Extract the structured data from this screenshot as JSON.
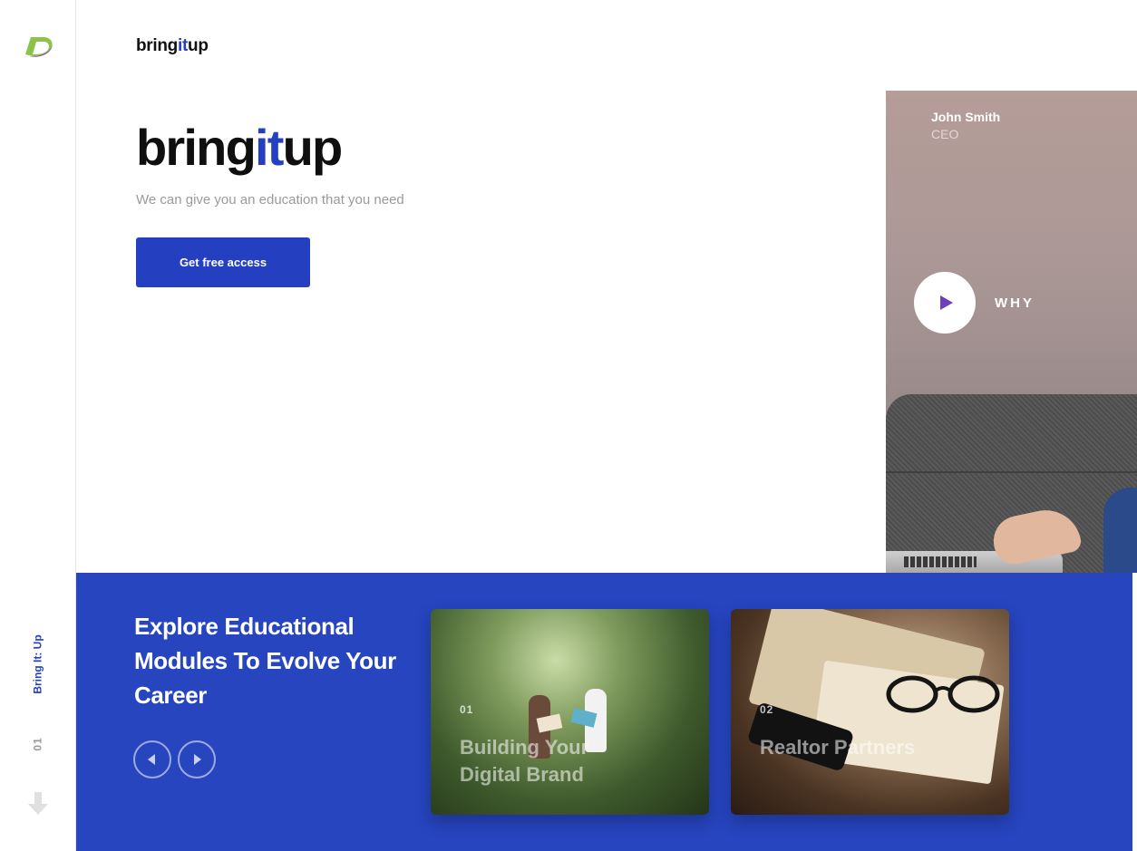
{
  "sidebar": {
    "vertical_label": "Bring It: Up",
    "slide_number": "01",
    "logo_icon": "brand-logo-icon",
    "arrow_icon": "arrow-down-icon"
  },
  "header": {
    "logo_prefix": "bring",
    "logo_it": "it",
    "logo_suffix": "up"
  },
  "hero": {
    "title_prefix": "bring",
    "title_it": "it",
    "title_suffix": "up",
    "subtitle": "We can give you an education that you need",
    "cta_label": "Get free access"
  },
  "video": {
    "person_name": "John Smith",
    "person_role": "CEO",
    "why_label": "WHY",
    "play_icon": "play-icon"
  },
  "modules": {
    "title": "Explore Educational Modules To Evolve Your Career",
    "prev_icon": "chevron-left-icon",
    "next_icon": "chevron-right-icon",
    "cards": [
      {
        "number": "01",
        "title": "Building Your Digital Brand"
      },
      {
        "number": "02",
        "title": "Realtor Partners"
      }
    ]
  },
  "colors": {
    "brand_blue": "#2440c0",
    "section_blue": "#2645bf",
    "play_purple": "#6b3fbf"
  }
}
